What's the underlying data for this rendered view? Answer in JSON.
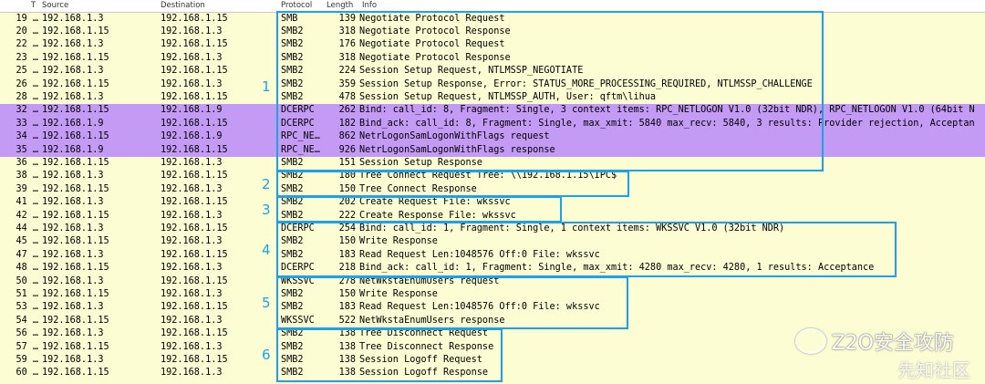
{
  "columns": {
    "no": "T",
    "source": "Source",
    "destination": "Destination",
    "protocol": "Protocol",
    "length": "Length",
    "info": "Info"
  },
  "packets": [
    {
      "no": "19 …",
      "src": "192.168.1.3",
      "dst": "192.168.1.15",
      "proto": "SMB",
      "len": "139",
      "info": "Negotiate Protocol Request",
      "color": "yellow"
    },
    {
      "no": "20 …",
      "src": "192.168.1.15",
      "dst": "192.168.1.3",
      "proto": "SMB2",
      "len": "318",
      "info": "Negotiate Protocol Response",
      "color": "yellow"
    },
    {
      "no": "22 …",
      "src": "192.168.1.3",
      "dst": "192.168.1.15",
      "proto": "SMB2",
      "len": "176",
      "info": "Negotiate Protocol Request",
      "color": "yellow"
    },
    {
      "no": "23 …",
      "src": "192.168.1.15",
      "dst": "192.168.1.3",
      "proto": "SMB2",
      "len": "318",
      "info": "Negotiate Protocol Response",
      "color": "yellow"
    },
    {
      "no": "25 …",
      "src": "192.168.1.3",
      "dst": "192.168.1.15",
      "proto": "SMB2",
      "len": "224",
      "info": "Session Setup Request, NTLMSSP_NEGOTIATE",
      "color": "yellow"
    },
    {
      "no": "26 …",
      "src": "192.168.1.15",
      "dst": "192.168.1.3",
      "proto": "SMB2",
      "len": "359",
      "info": "Session Setup Response, Error: STATUS_MORE_PROCESSING_REQUIRED, NTLMSSP_CHALLENGE",
      "color": "yellow"
    },
    {
      "no": "28 …",
      "src": "192.168.1.3",
      "dst": "192.168.1.15",
      "proto": "SMB2",
      "len": "478",
      "info": "Session Setup Request, NTLMSSP_AUTH, User: qftm\\lihua",
      "color": "yellow"
    },
    {
      "no": "32 …",
      "src": "192.168.1.15",
      "dst": "192.168.1.9",
      "proto": "DCERPC",
      "len": "262",
      "info": "Bind: call_id: 8, Fragment: Single, 3 context items: RPC_NETLOGON V1.0 (32bit NDR), RPC_NETLOGON V1.0 (64bit N",
      "color": "purple"
    },
    {
      "no": "33 …",
      "src": "192.168.1.9",
      "dst": "192.168.1.15",
      "proto": "DCERPC",
      "len": "182",
      "info": "Bind_ack: call_id: 8, Fragment: Single, max_xmit: 5840 max_recv: 5840, 3 results: Provider rejection, Acceptan",
      "color": "purple"
    },
    {
      "no": "34 …",
      "src": "192.168.1.15",
      "dst": "192.168.1.9",
      "proto": "RPC_NE…",
      "len": "862",
      "info": "NetrLogonSamLogonWithFlags request",
      "color": "purple"
    },
    {
      "no": "35 …",
      "src": "192.168.1.9",
      "dst": "192.168.1.15",
      "proto": "RPC_NE…",
      "len": "926",
      "info": "NetrLogonSamLogonWithFlags response",
      "color": "purple"
    },
    {
      "no": "36 …",
      "src": "192.168.1.15",
      "dst": "192.168.1.3",
      "proto": "SMB2",
      "len": "151",
      "info": "Session Setup Response",
      "color": "yellow"
    },
    {
      "no": "38 …",
      "src": "192.168.1.3",
      "dst": "192.168.1.15",
      "proto": "SMB2",
      "len": "180",
      "info": "Tree Connect Request Tree: \\\\192.168.1.15\\IPC$",
      "color": "yellow"
    },
    {
      "no": "39 …",
      "src": "192.168.1.15",
      "dst": "192.168.1.3",
      "proto": "SMB2",
      "len": "150",
      "info": "Tree Connect Response",
      "color": "yellow"
    },
    {
      "no": "41 …",
      "src": "192.168.1.3",
      "dst": "192.168.1.15",
      "proto": "SMB2",
      "len": "202",
      "info": "Create Request File: wkssvc",
      "color": "yellow"
    },
    {
      "no": "42 …",
      "src": "192.168.1.15",
      "dst": "192.168.1.3",
      "proto": "SMB2",
      "len": "222",
      "info": "Create Response File: wkssvc",
      "color": "yellow"
    },
    {
      "no": "44 …",
      "src": "192.168.1.3",
      "dst": "192.168.1.15",
      "proto": "DCERPC",
      "len": "254",
      "info": "Bind: call_id: 1, Fragment: Single, 1 context items: WKSSVC V1.0 (32bit NDR)",
      "color": "yellow"
    },
    {
      "no": "45 …",
      "src": "192.168.1.15",
      "dst": "192.168.1.3",
      "proto": "SMB2",
      "len": "150",
      "info": "Write Response",
      "color": "yellow"
    },
    {
      "no": "47 …",
      "src": "192.168.1.3",
      "dst": "192.168.1.15",
      "proto": "SMB2",
      "len": "183",
      "info": "Read Request Len:1048576 Off:0 File: wkssvc",
      "color": "yellow"
    },
    {
      "no": "48 …",
      "src": "192.168.1.15",
      "dst": "192.168.1.3",
      "proto": "DCERPC",
      "len": "218",
      "info": "Bind_ack: call_id: 1, Fragment: Single, max_xmit: 4280 max_recv: 4280, 1 results: Acceptance",
      "color": "yellow"
    },
    {
      "no": "50 …",
      "src": "192.168.1.3",
      "dst": "192.168.1.15",
      "proto": "WKSSVC",
      "len": "278",
      "info": "NetWkstaEnumUsers request",
      "color": "yellow"
    },
    {
      "no": "51 …",
      "src": "192.168.1.15",
      "dst": "192.168.1.3",
      "proto": "SMB2",
      "len": "150",
      "info": "Write Response",
      "color": "yellow"
    },
    {
      "no": "53 …",
      "src": "192.168.1.3",
      "dst": "192.168.1.15",
      "proto": "SMB2",
      "len": "183",
      "info": "Read Request Len:1048576 Off:0 File: wkssvc",
      "color": "yellow"
    },
    {
      "no": "54 …",
      "src": "192.168.1.15",
      "dst": "192.168.1.3",
      "proto": "WKSSVC",
      "len": "522",
      "info": "NetWkstaEnumUsers response",
      "color": "yellow"
    },
    {
      "no": "56 …",
      "src": "192.168.1.3",
      "dst": "192.168.1.15",
      "proto": "SMB2",
      "len": "138",
      "info": "Tree Disconnect Request",
      "color": "yellow"
    },
    {
      "no": "57 …",
      "src": "192.168.1.15",
      "dst": "192.168.1.3",
      "proto": "SMB2",
      "len": "138",
      "info": "Tree Disconnect Response",
      "color": "yellow"
    },
    {
      "no": "59 …",
      "src": "192.168.1.3",
      "dst": "192.168.1.15",
      "proto": "SMB2",
      "len": "138",
      "info": "Session Logoff Request",
      "color": "yellow"
    },
    {
      "no": "60 …",
      "src": "192.168.1.15",
      "dst": "192.168.1.3",
      "proto": "SMB2",
      "len": "138",
      "info": "Session Logoff Response",
      "color": "yellow"
    }
  ],
  "groups": [
    {
      "label": "1"
    },
    {
      "label": "2"
    },
    {
      "label": "3"
    },
    {
      "label": "4"
    },
    {
      "label": "5"
    },
    {
      "label": "6"
    }
  ],
  "watermark": {
    "text": "Z2O安全攻防",
    "text2": "先知社区"
  },
  "colors": {
    "yellow": "#fdfdd4",
    "purple": "#c39bf5",
    "box": "#1aa3e8"
  }
}
